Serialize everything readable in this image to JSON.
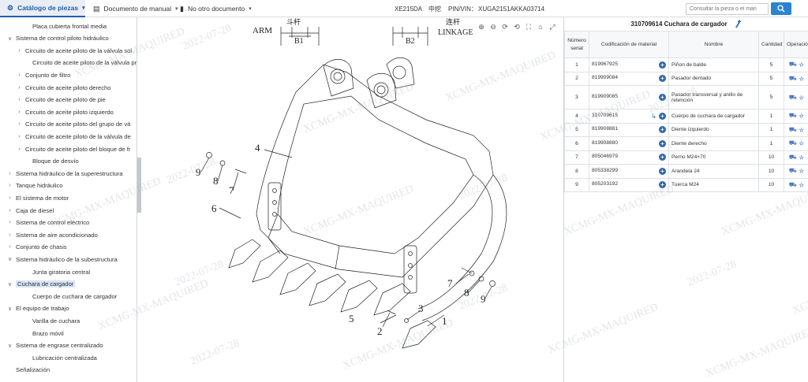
{
  "topbar": {
    "tab_catalog": "Catálogo de piezas",
    "tab_manual": "Documento de manual",
    "tab_other": "No otro documento",
    "model": "XE215DA",
    "brand": "中挖",
    "pin_label": "PIN/VIN：",
    "pin_value": "XUGA2151AKKA03714",
    "search_placeholder": "Consultar la pieza o el man"
  },
  "sidebar": {
    "items": [
      {
        "label": "Placa cubierta frontal media",
        "level": 2,
        "toggle": ""
      },
      {
        "label": "Sistema de control piloto hidráulico",
        "level": 0,
        "toggle": "down"
      },
      {
        "label": "Circuito de aceite piloto de la válvula sol",
        "level": 1,
        "toggle": "right"
      },
      {
        "label": "Circuito de aceite piloto de la válvula pr",
        "level": 2,
        "toggle": ""
      },
      {
        "label": "Conjunto de filtro",
        "level": 1,
        "toggle": "right"
      },
      {
        "label": "Circuito de aceite piloto derecho",
        "level": 1,
        "toggle": "right"
      },
      {
        "label": "Circuito de aceite piloto de pie",
        "level": 1,
        "toggle": "right"
      },
      {
        "label": "Circuito de aceite piloto izquierdo",
        "level": 1,
        "toggle": "right"
      },
      {
        "label": "Circuito de aceite piloto del grupo de vá",
        "level": 1,
        "toggle": "right"
      },
      {
        "label": "Circuito de aceite piloto de la válvula de",
        "level": 1,
        "toggle": "right"
      },
      {
        "label": "Circuito de aceite piloto del bloque de fr",
        "level": 1,
        "toggle": "right"
      },
      {
        "label": "Bloque de desvío",
        "level": 2,
        "toggle": ""
      },
      {
        "label": "Sistema hidráulico de la superestructura",
        "level": 0,
        "toggle": "right"
      },
      {
        "label": "Tanque hidráulico",
        "level": 0,
        "toggle": "right"
      },
      {
        "label": "El sistema de motor",
        "level": 0,
        "toggle": "right"
      },
      {
        "label": "Caja de diesel",
        "level": 0,
        "toggle": "right"
      },
      {
        "label": "Sistema de control eléctrico",
        "level": 0,
        "toggle": "right"
      },
      {
        "label": "Sistema de aire acondicionado",
        "level": 0,
        "toggle": "right"
      },
      {
        "label": "Conjunto de chasis",
        "level": 0,
        "toggle": "right"
      },
      {
        "label": "Sistema hidráulico de la subestructura",
        "level": 0,
        "toggle": "down"
      },
      {
        "label": "Junta giratoria central",
        "level": 2,
        "toggle": ""
      },
      {
        "label": "Cuchara de cargador",
        "level": 0,
        "toggle": "down",
        "selected": true
      },
      {
        "label": "Cuerpo de cuchara de cargador",
        "level": 2,
        "toggle": ""
      },
      {
        "label": "El equipo de trabajo",
        "level": 0,
        "toggle": "down"
      },
      {
        "label": "Varilla de cuchara",
        "level": 2,
        "toggle": ""
      },
      {
        "label": "Brazo móvil",
        "level": 2,
        "toggle": ""
      },
      {
        "label": "Sistema de engrase centralizado",
        "level": 0,
        "toggle": "down"
      },
      {
        "label": "Lubricación centralizada",
        "level": 2,
        "toggle": ""
      },
      {
        "label": "Señalización",
        "level": 0,
        "toggle": ""
      }
    ]
  },
  "drawing": {
    "arm_cn": "斗杆",
    "arm": "ARM",
    "b1": "B1",
    "link_cn": "连杆",
    "linkage": "LINKAGE",
    "b2": "B2",
    "callouts": [
      "1",
      "2",
      "3",
      "4",
      "5",
      "6",
      "7",
      "8",
      "9",
      "7",
      "8",
      "9"
    ]
  },
  "watermark": {
    "text": "XCMG-MX-MAQUIRED",
    "date": "2022-07-28"
  },
  "parts": {
    "title": "310709614 Cuchara de cargador",
    "headers": {
      "num": "Número serial",
      "code": "Codificación de material",
      "name": "Nombre",
      "qty": "Cantidad",
      "ops": "Operación"
    },
    "rows": [
      {
        "num": "1",
        "code": "819967925",
        "name": "Piñon de balde",
        "qty": "5"
      },
      {
        "num": "2",
        "code": "819909084",
        "name": "Pasador dentado",
        "qty": "5"
      },
      {
        "num": "3",
        "name": "Pasador transversal y anillo de retención",
        "code": "819909085",
        "qty": "5"
      },
      {
        "num": "4",
        "code": "310709615",
        "name": "Cuerpo de cuchara de cargador",
        "qty": "1"
      },
      {
        "num": "5",
        "code": "819908881",
        "name": "Diente izquierdo",
        "qty": "1"
      },
      {
        "num": "6",
        "code": "819908880",
        "name": "Diente derecho",
        "qty": "1"
      },
      {
        "num": "7",
        "code": "805046979",
        "name": "Perno M24×70",
        "qty": "10"
      },
      {
        "num": "8",
        "code": "805338299",
        "name": "Arandela 24",
        "qty": "10"
      },
      {
        "num": "9",
        "code": "805203192",
        "name": "Tuerca M24",
        "qty": "10"
      }
    ]
  }
}
